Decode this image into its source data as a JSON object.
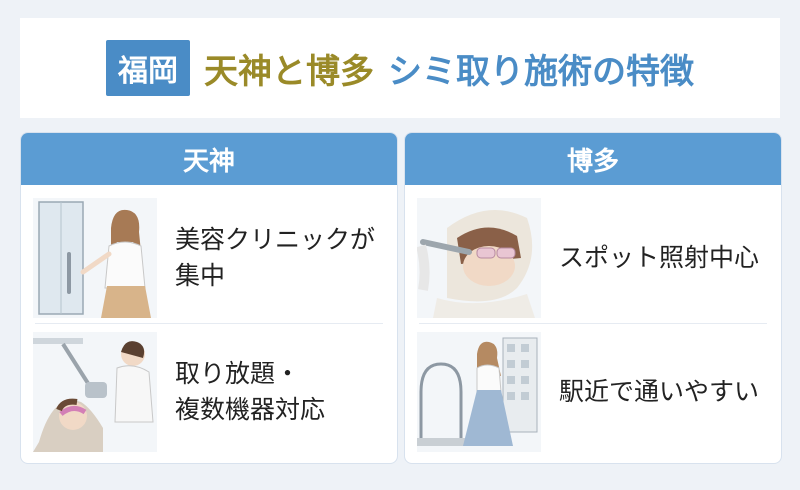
{
  "header": {
    "tag": "福岡",
    "title_gold": "天神と博多",
    "title_blue": "シミ取り施術の特徴"
  },
  "left_card": {
    "heading": "天神",
    "items": [
      {
        "line1": "美容クリニックが",
        "line2": "集中"
      },
      {
        "line1": "取り放題・",
        "line2": "複数機器対応"
      }
    ]
  },
  "right_card": {
    "heading": "博多",
    "items": [
      {
        "line1": "スポット照射中心"
      },
      {
        "line1": "駅近で通いやすい"
      }
    ]
  },
  "colors": {
    "accent_blue": "#5b9cd3",
    "tag_blue": "#4a8cc6",
    "gold": "#9a8a28",
    "background": "#eef2f7"
  }
}
